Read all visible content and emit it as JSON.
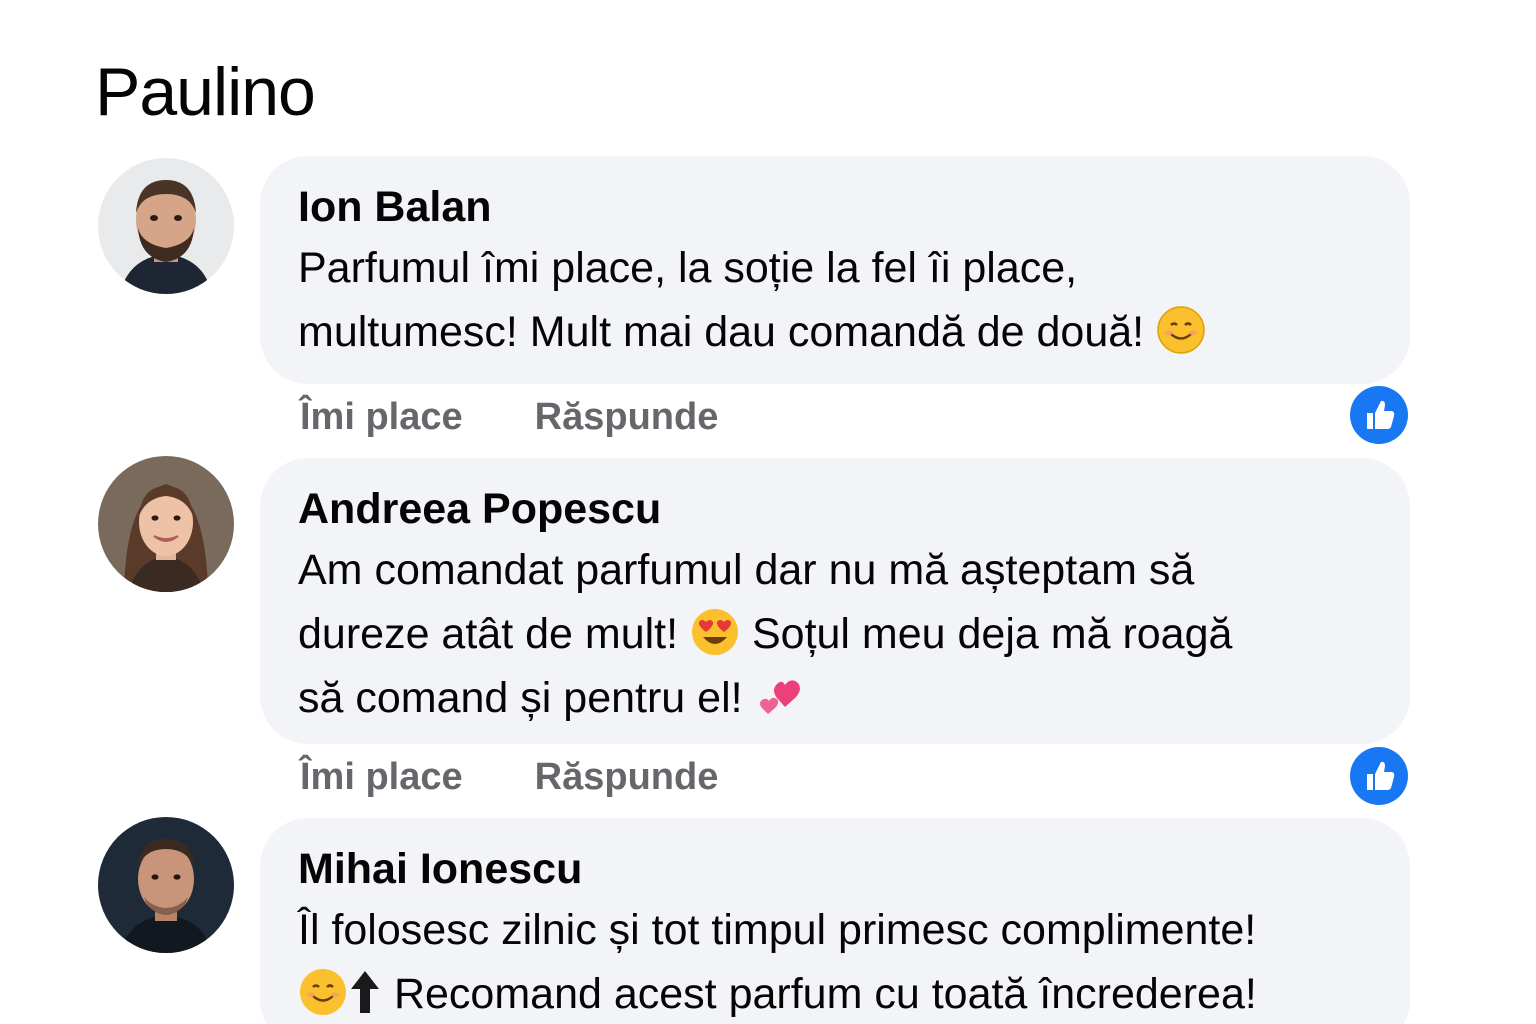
{
  "page": {
    "title": "Paulino"
  },
  "colors": {
    "like_blue": "#1877f2",
    "bubble_bg": "#f3f4f8",
    "action_gray": "#65676b"
  },
  "comments": [
    {
      "author": "Ion Balan",
      "text_lines": [
        "Parfumul îmi place, la soție la fel îi place,",
        "multumesc! Mult mai dau comandă de două!"
      ],
      "emoji_after": "smiling-face-icon",
      "like_label": "Îmi place",
      "reply_label": "Răspunde",
      "reaction_icon": "thumbs-up-icon"
    },
    {
      "author": "Andreea Popescu",
      "text_lines": [
        "Am comandat parfumul dar nu mă așteptam să",
        "dureze atât de mult!",
        "Soțul meu deja mă roagă",
        "să comand și pentru el!"
      ],
      "emojis": [
        "heart-eyes-icon",
        "two-hearts-icon"
      ],
      "like_label": "Îmi place",
      "reply_label": "Răspunde",
      "reaction_icon": "thumbs-up-icon"
    },
    {
      "author": "Mihai Ionescu",
      "text_lines": [
        "Îl folosesc zilnic și tot timpul primesc complimente!",
        "Recomand acest parfum cu toată încrederea!"
      ],
      "emojis": [
        "smiling-face-icon",
        "up-arrow-icon"
      ]
    }
  ]
}
